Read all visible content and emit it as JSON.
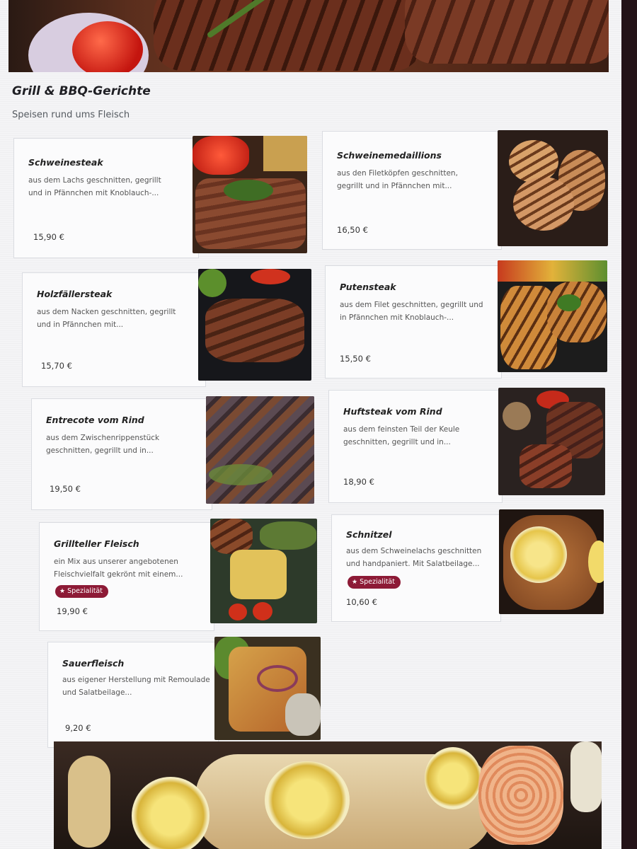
{
  "section": {
    "title": "Grill & BBQ-Gerichte",
    "subtitle": "Speisen rund ums Fleisch"
  },
  "badge_label": "Spezialität",
  "dishes": [
    {
      "name": "Schweinesteak",
      "desc": "aus dem Lachs geschnitten, gegrillt und in Pfännchen mit Knoblauch-...",
      "price": "15,90 €",
      "photo_icon": "pork-steak-photo"
    },
    {
      "name": "Schweinemedaillions",
      "desc": "aus den Filetköpfen geschnitten, gegrillt und in Pfännchen mit...",
      "price": "16,50 €",
      "photo_icon": "pork-medallions-photo"
    },
    {
      "name": "Holzfällersteak",
      "desc": "aus dem Nacken geschnitten, gegrillt und in Pfännchen mit...",
      "price": "15,70 €",
      "photo_icon": "lumberjack-steak-photo"
    },
    {
      "name": "Putensteak",
      "desc": "aus dem Filet geschnitten, gegrillt und in Pfännchen mit Knoblauch-...",
      "price": "15,50 €",
      "photo_icon": "turkey-steak-photo"
    },
    {
      "name": "Entrecote vom Rind",
      "desc": "aus dem Zwischenrippenstück geschnitten, gegrillt und in...",
      "price": "19,50 €",
      "photo_icon": "entrecote-photo"
    },
    {
      "name": "Huftsteak vom Rind",
      "desc": "aus dem feinsten Teil der Keule geschnitten, gegrillt und in...",
      "price": "18,90 €",
      "photo_icon": "rump-steak-photo"
    },
    {
      "name": "Grillteller Fleisch",
      "desc": "ein Mix aus unserer angebotenen Fleischvielfalt gekrönt mit einem...",
      "price": "19,90 €",
      "special": true,
      "photo_icon": "grill-plate-photo"
    },
    {
      "name": "Schnitzel",
      "desc": "aus dem Schweinelachs geschnitten und handpaniert. Mit Salatbeilage...",
      "price": "10,60 €",
      "special": true,
      "photo_icon": "schnitzel-photo"
    },
    {
      "name": "Sauerfleisch",
      "desc": "aus eigener Herstellung mit Remoulade und Salatbeilage...",
      "price": "9,20 €",
      "photo_icon": "sauerfleisch-photo"
    }
  ],
  "colors": {
    "badge": "#8d1a36",
    "page_bg": "#f4f4f6",
    "bezel": "#241318"
  }
}
